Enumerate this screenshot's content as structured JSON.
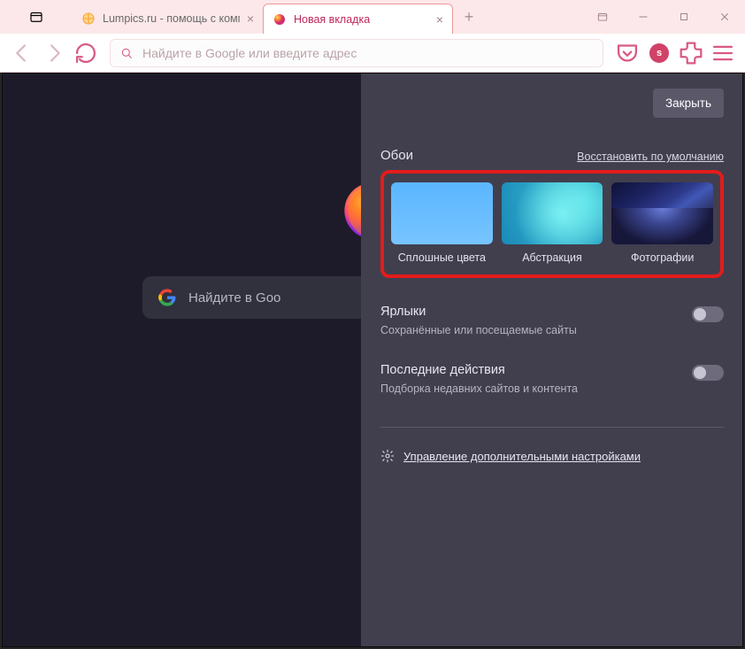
{
  "tabs": [
    {
      "label": "Lumpics.ru - помощь с компь"
    },
    {
      "label": "Новая вкладка"
    }
  ],
  "urlbar": {
    "placeholder": "Найдите в Google или введите адрес"
  },
  "avatarInitial": "s",
  "newtab": {
    "search_placeholder": "Найдите в Goo"
  },
  "panel": {
    "close": "Закрыть",
    "wallpapers": {
      "title": "Обои",
      "reset": "Восстановить по умолчанию",
      "items": [
        {
          "label": "Сплошные цвета"
        },
        {
          "label": "Абстракция"
        },
        {
          "label": "Фотографии"
        }
      ]
    },
    "shortcuts": {
      "title": "Ярлыки",
      "desc": "Сохранённые или посещаемые сайты"
    },
    "recent": {
      "title": "Последние действия",
      "desc": "Подборка недавних сайтов и контента"
    },
    "more": "Управление дополнительными настройками"
  }
}
